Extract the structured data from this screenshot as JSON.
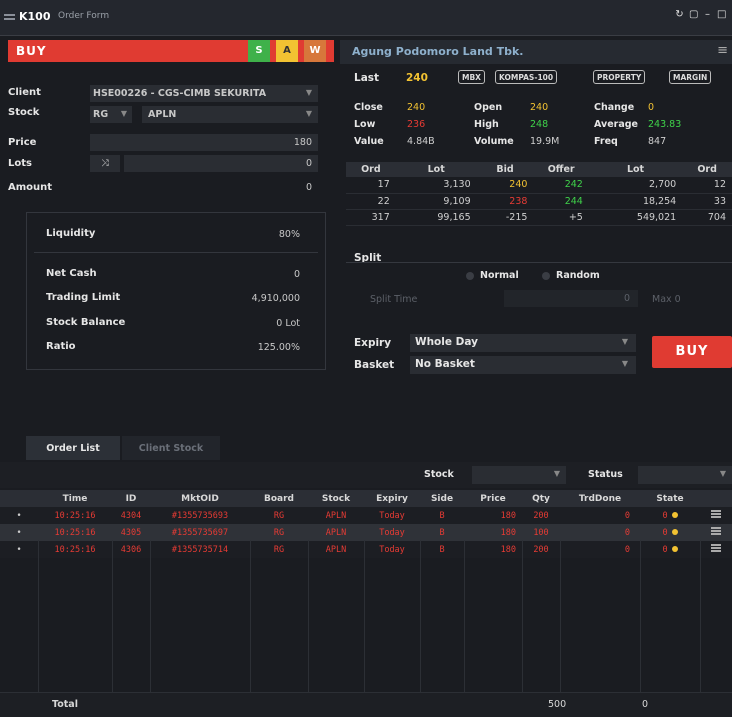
{
  "window": {
    "app": "K100",
    "title": "Order Form"
  },
  "order": {
    "side_label": "BUY",
    "side_buttons": [
      {
        "label": "S",
        "color": "#3fb14a"
      },
      {
        "label": "A",
        "color": "#f2c232"
      },
      {
        "label": "W",
        "color": "#d7773b"
      }
    ],
    "client_label": "Client",
    "client_value": "HSE00226 - CGS-CIMB SEKURITA",
    "stock_label": "Stock",
    "board_value": "RG",
    "stock_value": "APLN",
    "price_label": "Price",
    "price_value": "180",
    "lots_label": "Lots",
    "lots_value": "0",
    "amount_label": "Amount",
    "amount_value": "0"
  },
  "account": {
    "liquidity_label": "Liquidity",
    "liquidity_value": "80%",
    "net_cash_label": "Net Cash",
    "net_cash_value": "0",
    "trading_limit_label": "Trading Limit",
    "trading_limit_value": "4,910,000",
    "stock_balance_label": "Stock Balance",
    "stock_balance_value": "0 Lot",
    "ratio_label": "Ratio",
    "ratio_value": "125.00%"
  },
  "quote": {
    "company": "Agung Podomoro Land Tbk.",
    "last_label": "Last",
    "last_value": "240",
    "tags": [
      "MBX",
      "KOMPAS-100",
      "PROPERTY",
      "MARGIN"
    ],
    "close_label": "Close",
    "close_value": "240",
    "open_label": "Open",
    "open_value": "240",
    "change_label": "Change",
    "change_value": "0",
    "low_label": "Low",
    "low_value": "236",
    "high_label": "High",
    "high_value": "248",
    "average_label": "Average",
    "average_value": "243.83",
    "value_label": "Value",
    "value_value": "4.84B",
    "volume_label": "Volume",
    "volume_value": "19.9M",
    "freq_label": "Freq",
    "freq_value": "847"
  },
  "orderbook": {
    "headers": [
      "Ord",
      "Lot",
      "Bid",
      "Offer",
      "Lot",
      "Ord"
    ],
    "rows": [
      [
        "17",
        "3,130",
        "240",
        "242",
        "2,700",
        "12"
      ],
      [
        "22",
        "9,109",
        "238",
        "244",
        "18,254",
        "33"
      ],
      [
        "317",
        "99,165",
        "-215",
        "+5",
        "549,021",
        "704"
      ]
    ]
  },
  "split": {
    "title": "Split",
    "normal": "Normal",
    "random": "Random",
    "split_time": "Split Time",
    "split_time_value": "0",
    "max_label": "Max 0"
  },
  "expiry": {
    "label": "Expiry",
    "value": "Whole Day"
  },
  "basket": {
    "label": "Basket",
    "value": "No Basket"
  },
  "buy_button": "BUY",
  "tabs": [
    "Order List",
    "Client Stock"
  ],
  "filters": {
    "stock_label": "Stock",
    "status_label": "Status"
  },
  "orders": {
    "headers": [
      "Time",
      "ID",
      "MktOID",
      "Board",
      "Stock",
      "Expiry",
      "Side",
      "Price",
      "Qty",
      "TrdDone",
      "State"
    ],
    "rows": [
      [
        "10:25:16",
        "4304",
        "#1355735693",
        "RG",
        "APLN",
        "Today",
        "B",
        "180",
        "200",
        "0",
        "0"
      ],
      [
        "10:25:16",
        "4305",
        "#1355735697",
        "RG",
        "APLN",
        "Today",
        "B",
        "180",
        "100",
        "0",
        "0"
      ],
      [
        "10:25:16",
        "4306",
        "#1355735714",
        "RG",
        "APLN",
        "Today",
        "B",
        "180",
        "200",
        "0",
        "0"
      ]
    ],
    "total_label": "Total",
    "total_qty": "500",
    "total_trd": "0"
  }
}
